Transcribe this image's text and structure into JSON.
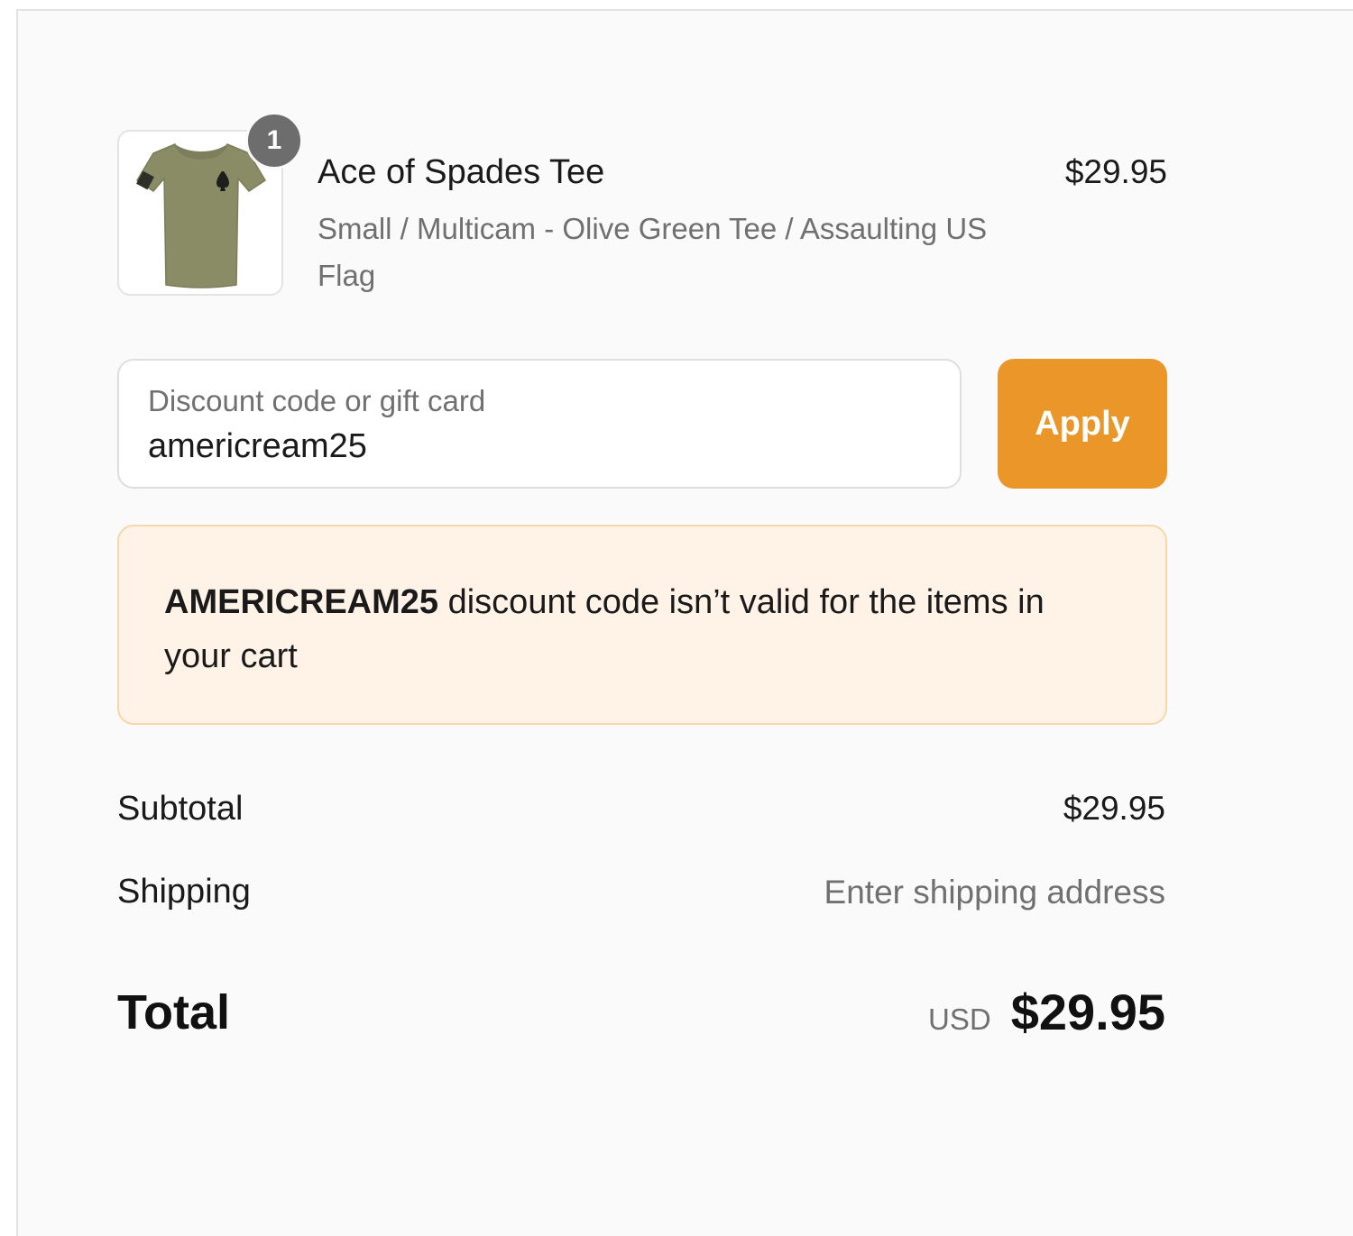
{
  "cart": {
    "item": {
      "title": "Ace of Spades Tee",
      "variant": "Small / Multicam - Olive Green Tee / Assaulting US Flag",
      "price": "$29.95",
      "quantity": "1",
      "thumbnail_icon": "olive-tshirt-image"
    }
  },
  "discount": {
    "label": "Discount code or gift card",
    "value": "americream25",
    "apply_label": "Apply",
    "error_code": "AMERICREAM25",
    "error_message": " discount code isn’t valid for the items in your cart"
  },
  "summary": {
    "subtotal_label": "Subtotal",
    "subtotal_value": "$29.95",
    "shipping_label": "Shipping",
    "shipping_value": "Enter shipping address",
    "total_label": "Total",
    "currency": "USD",
    "total_value": "$29.95"
  },
  "colors": {
    "accent": "#ea9628",
    "error_bg": "#fff3e8",
    "error_border": "#f6d6aa",
    "badge": "#6d6d6d"
  }
}
